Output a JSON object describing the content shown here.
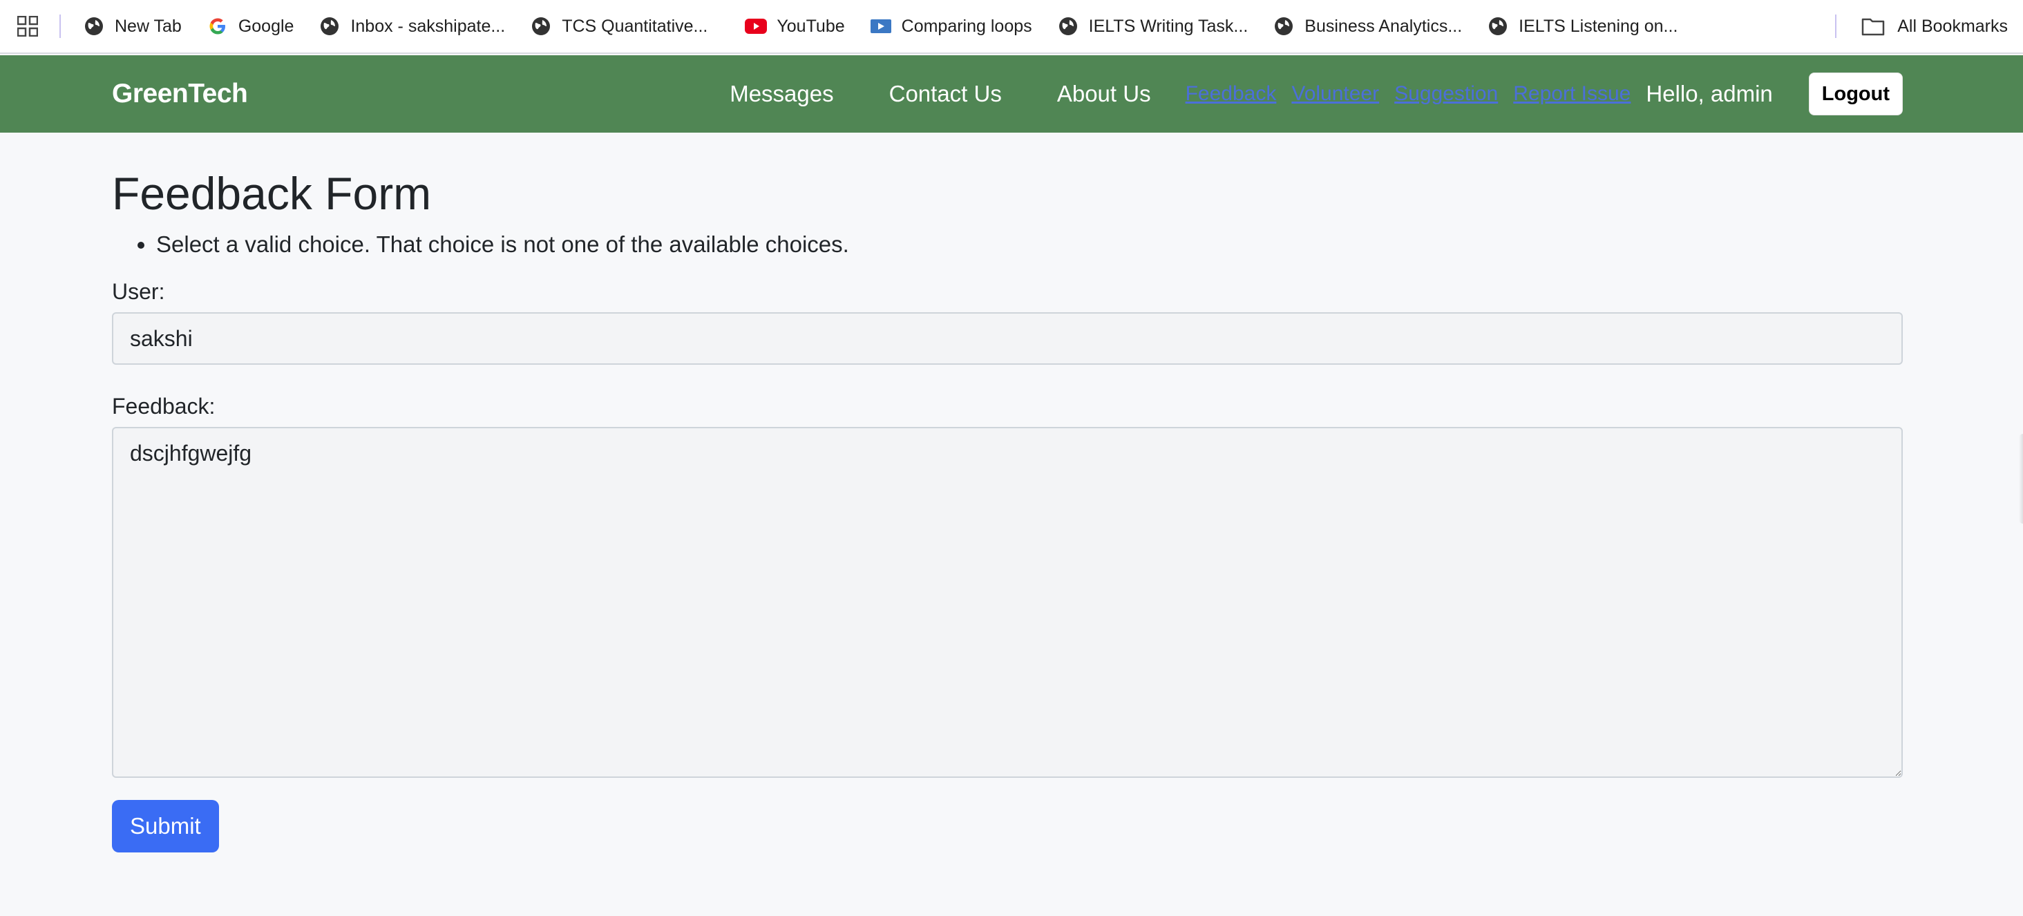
{
  "bookmarks": {
    "items": [
      {
        "label": "New Tab",
        "icon": "globe-icon"
      },
      {
        "label": "Google",
        "icon": "google-icon"
      },
      {
        "label": "Inbox - sakshipate...",
        "icon": "globe-icon"
      },
      {
        "label": "TCS Quantitative...",
        "icon": "globe-icon"
      },
      {
        "label": "YouTube",
        "icon": "youtube-icon"
      },
      {
        "label": "Comparing loops",
        "icon": "video-icon"
      },
      {
        "label": "IELTS Writing Task...",
        "icon": "globe-icon"
      },
      {
        "label": "Business Analytics...",
        "icon": "globe-icon"
      },
      {
        "label": "IELTS Listening on...",
        "icon": "globe-icon"
      }
    ],
    "all_bookmarks_label": "All Bookmarks"
  },
  "navbar": {
    "brand": "GreenTech",
    "links": [
      "Messages",
      "Contact Us",
      "About Us"
    ],
    "underlined_links": [
      "Feedback",
      "Volunteer",
      "Suggestion",
      "Report Issue"
    ],
    "greeting": "Hello, admin",
    "logout_label": "Logout",
    "colors": {
      "background": "#508654",
      "link_color": "#4b6fd9"
    }
  },
  "form": {
    "title": "Feedback Form",
    "errors": [
      "Select a valid choice. That choice is not one of the available choices."
    ],
    "user_label": "User:",
    "user_value": "sakshi",
    "feedback_label": "Feedback:",
    "feedback_value": "dscjhfgwejfg",
    "submit_label": "Submit",
    "colors": {
      "submit": "#3a6cf4"
    }
  }
}
